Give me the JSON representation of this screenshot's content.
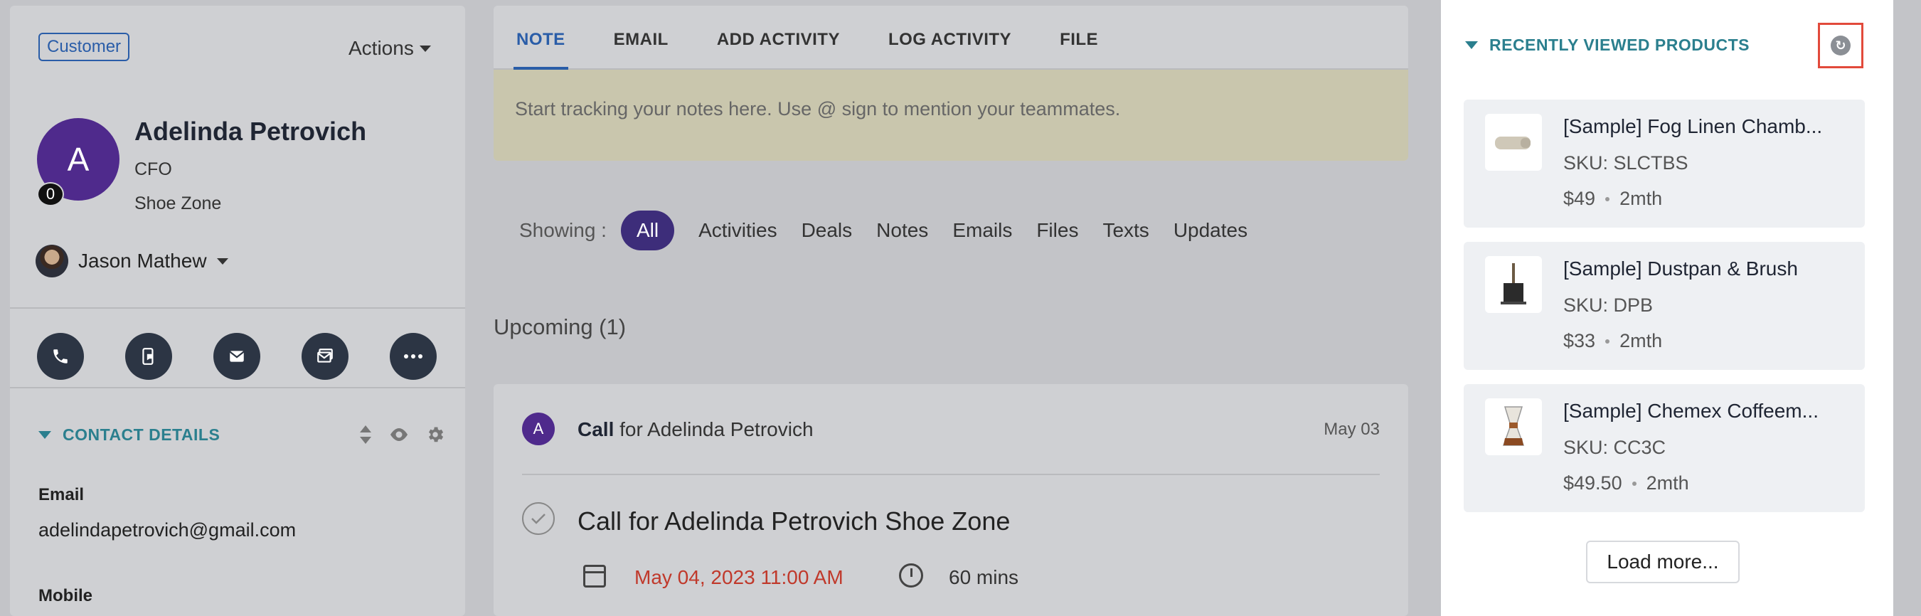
{
  "contact": {
    "badge": "Customer",
    "actions_label": "Actions",
    "avatar_initial": "A",
    "avatar_count": "0",
    "name": "Adelinda Petrovich",
    "title": "CFO",
    "company": "Shoe Zone",
    "owner": "Jason Mathew"
  },
  "quick_actions": [
    {
      "icon": "phone-icon"
    },
    {
      "icon": "sms-icon"
    },
    {
      "icon": "email-icon"
    },
    {
      "icon": "sequence-icon"
    },
    {
      "icon": "more-icon"
    }
  ],
  "contact_details": {
    "title": "CONTACT DETAILS",
    "email_label": "Email",
    "email_value": "adelindapetrovich@gmail.com",
    "mobile_label": "Mobile"
  },
  "composer": {
    "tabs": [
      "NOTE",
      "EMAIL",
      "ADD ACTIVITY",
      "LOG ACTIVITY",
      "FILE"
    ],
    "note_placeholder": "Start tracking your notes here. Use @ sign to mention your teammates."
  },
  "filters": {
    "label": "Showing :",
    "options": [
      "All",
      "Activities",
      "Deals",
      "Notes",
      "Emails",
      "Files",
      "Texts",
      "Updates"
    ]
  },
  "upcoming": {
    "heading": "Upcoming (1)",
    "activity": {
      "avatar_initial": "A",
      "type": "Call",
      "for_text": "for Adelinda Petrovich",
      "date": "May 03",
      "title": "Call for Adelinda Petrovich Shoe Zone",
      "due": "May 04, 2023 11:00 AM",
      "duration": "60 mins"
    }
  },
  "recently_viewed": {
    "title": "RECENTLY VIEWED PRODUCTS",
    "products": [
      {
        "name": "[Sample] Fog Linen Chamb...",
        "sku": "SKU: SLCTBS",
        "price": "$49",
        "age": "2mth"
      },
      {
        "name": "[Sample] Dustpan & Brush",
        "sku": "SKU: DPB",
        "price": "$33",
        "age": "2mth"
      },
      {
        "name": "[Sample] Chemex Coffeem...",
        "sku": "SKU: CC3C",
        "price": "$49.50",
        "age": "2mth"
      }
    ],
    "load_more": "Load more..."
  },
  "colors": {
    "accent": "#2a5da8",
    "section_teal": "#2b7f8e",
    "avatar_purple": "#4f2a8c",
    "highlight_red": "#e24a3b",
    "due_red": "#c0392b"
  }
}
